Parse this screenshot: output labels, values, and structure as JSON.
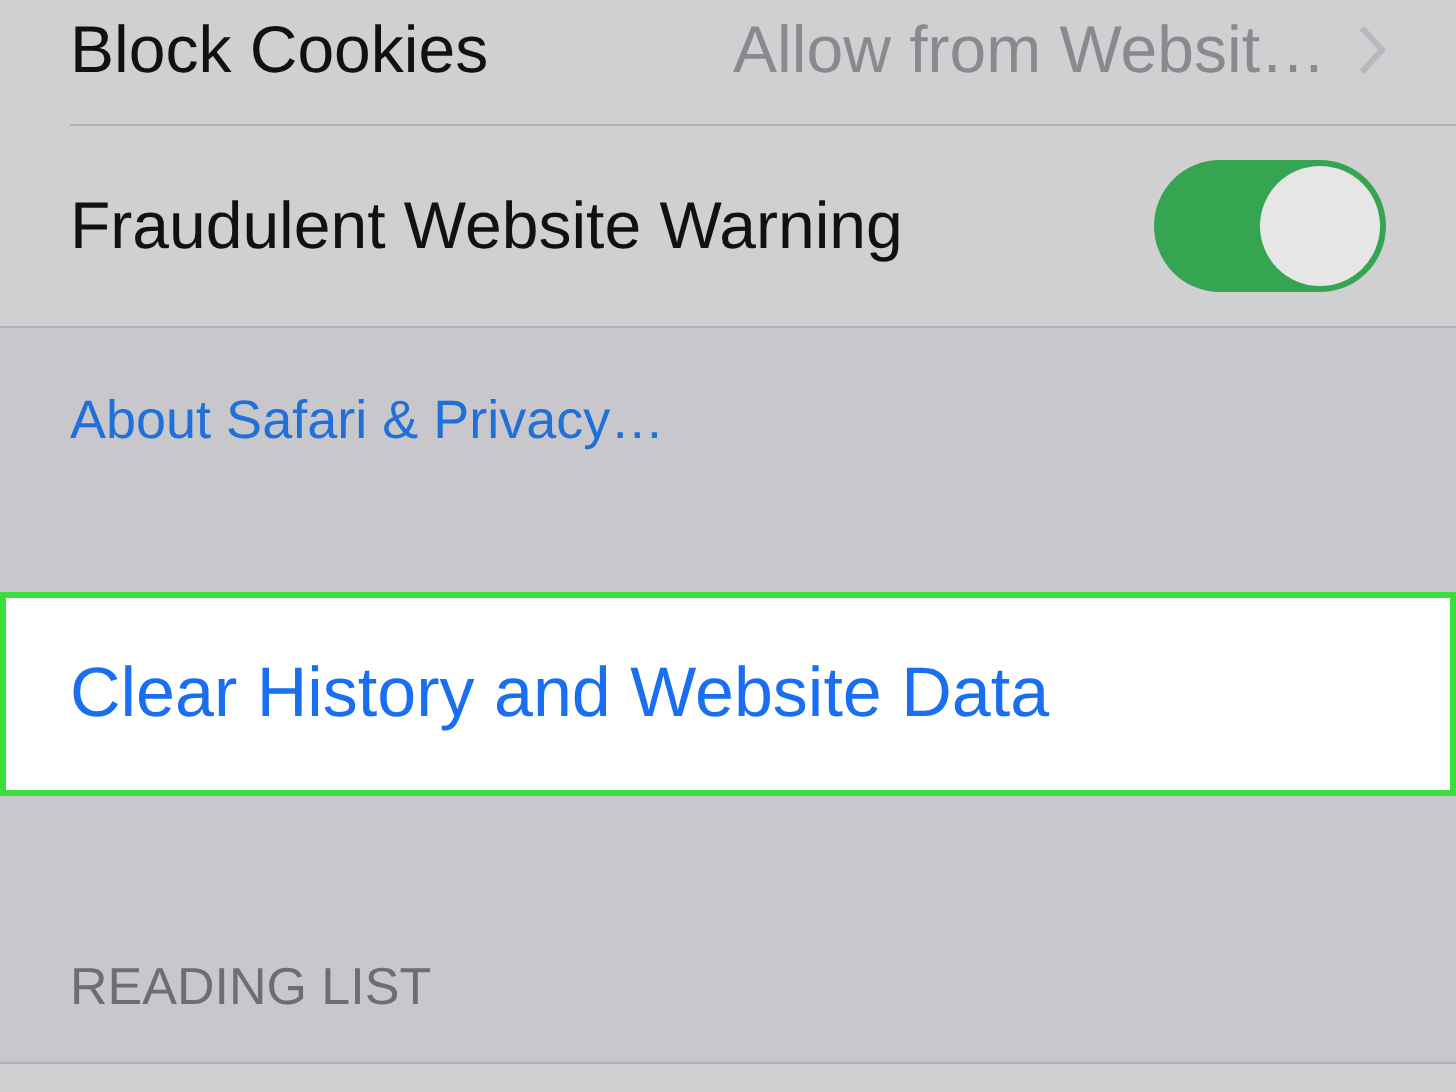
{
  "settings_rows": [
    {
      "kind": "value",
      "label": "Block Cookies",
      "value": "Allow from Websit…"
    },
    {
      "kind": "toggle",
      "label": "Fraudulent Website Warning",
      "on": true
    }
  ],
  "footer_link": "About Safari & Privacy…",
  "action": {
    "label": "Clear History and Website Data",
    "highlighted": true
  },
  "section_header": "READING LIST"
}
